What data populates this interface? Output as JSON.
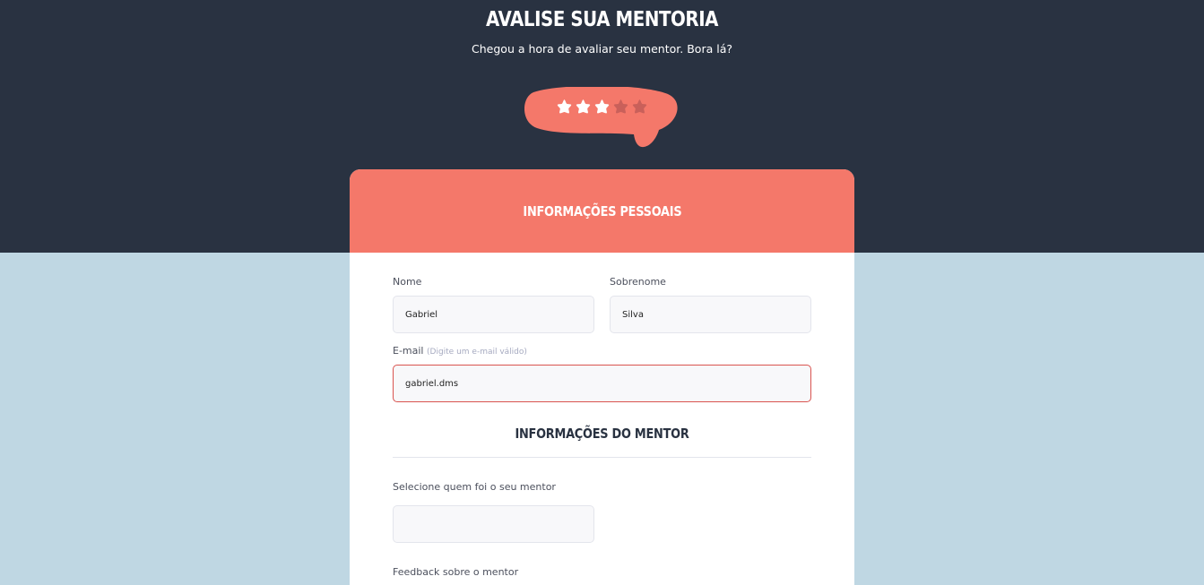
{
  "header": {
    "title": "AVALISE SUA MENTORIA",
    "subtitle": "Chegou a hora de avaliar seu mentor. Bora lá?"
  },
  "rating": {
    "value": 3,
    "max": 5,
    "bubble_color": "#f4786a",
    "star_active_color": "#ffffff",
    "star_inactive_color": "#c9605a"
  },
  "personal_section": {
    "title": "INFORMAÇÕES PESSOAIS",
    "first_name_label": "Nome",
    "first_name_value": "Gabriel",
    "last_name_label": "Sobrenome",
    "last_name_value": "Silva",
    "email_label": "E-mail",
    "email_hint": "(Digite um e-mail válido)",
    "email_value": "gabriel.dms"
  },
  "mentor_section": {
    "title": "INFORMAÇÕES DO MENTOR",
    "select_label": "Selecione quem foi o seu mentor",
    "select_value": "",
    "feedback_label": "Feedback sobre o mentor"
  },
  "colors": {
    "dark_band": "#293241",
    "light_background": "#bfd7e3",
    "accent": "#f4786a",
    "error_border": "#d9534f"
  }
}
